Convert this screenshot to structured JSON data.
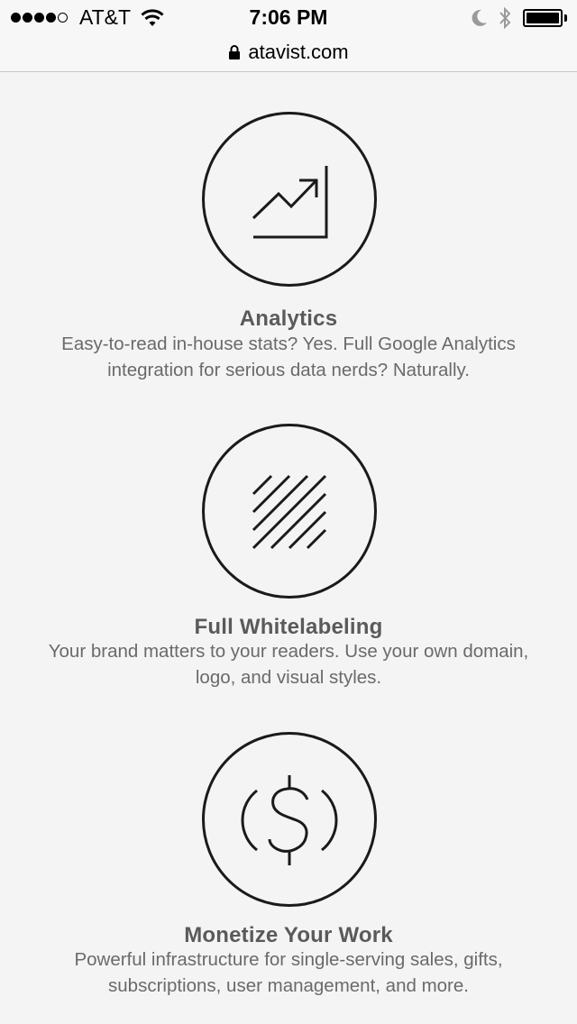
{
  "status_bar": {
    "carrier": "AT&T",
    "time": "7:06 PM",
    "signal_bars_filled": 4,
    "signal_bars_total": 5,
    "battery_level": 1.0,
    "icons": [
      "wifi-icon",
      "moon-icon",
      "bluetooth-icon",
      "battery-icon"
    ]
  },
  "url_bar": {
    "url": "atavist.com",
    "icon": "lock-icon"
  },
  "features": [
    {
      "icon": "analytics-chart-icon",
      "title": "Analytics",
      "description_line1": "Easy-to-read in-house stats? Yes. Full Google Analytics",
      "description_line2": "integration for serious data nerds? Naturally."
    },
    {
      "icon": "whitelabel-stripes-icon",
      "title": "Full Whitelabeling",
      "description_line1": "Your brand matters to your readers. Use your own domain,",
      "description_line2": "logo, and visual styles."
    },
    {
      "icon": "dollar-sign-icon",
      "title": "Monetize Your Work",
      "description_line1": "Powerful infrastructure for single-serving sales, gifts,",
      "description_line2": "subscriptions, user management, and more."
    }
  ],
  "colors": {
    "background": "#f4f4f5",
    "icon_stroke": "#1a1a1a",
    "title": "#5a5a5a",
    "description": "#6a6a6a"
  }
}
